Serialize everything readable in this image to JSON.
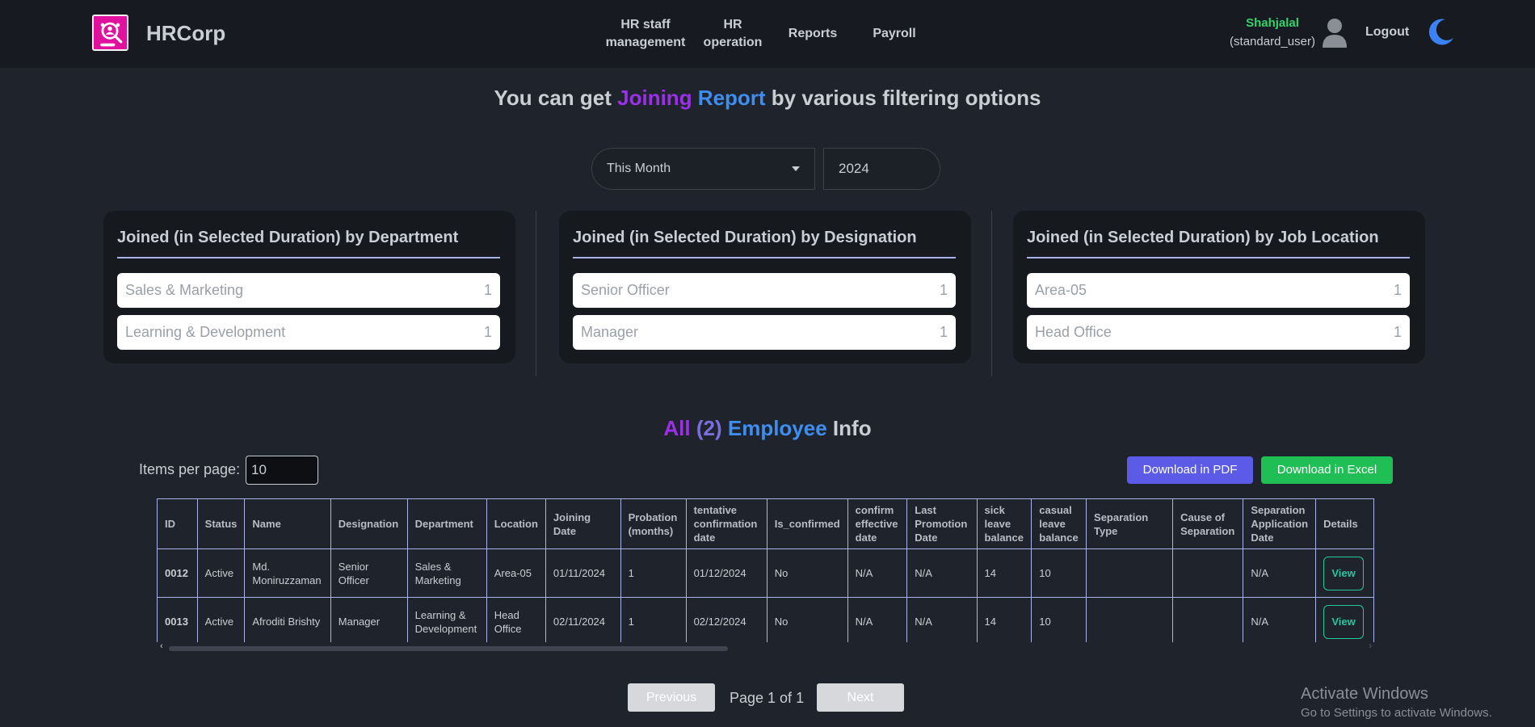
{
  "navbar": {
    "brand": "HRCorp",
    "items": [
      {
        "line1": "HR staff",
        "line2": "management"
      },
      {
        "line1": "HR",
        "line2": "operation"
      },
      {
        "line1": "Reports",
        "line2": ""
      },
      {
        "line1": "Payroll",
        "line2": ""
      }
    ],
    "user_name": "Shahjalal",
    "user_role": "(standard_user)",
    "logout": "Logout"
  },
  "heading": {
    "prefix": "You can get ",
    "word1": "Joining",
    "word2": " Report",
    "suffix": " by various filtering options"
  },
  "filters": {
    "duration": "This Month",
    "year": "2024"
  },
  "cards": [
    {
      "title": "Joined (in Selected Duration) by Department",
      "rows": [
        {
          "label": "Sales & Marketing",
          "count": "1"
        },
        {
          "label": "Learning & Development",
          "count": "1"
        }
      ]
    },
    {
      "title": "Joined (in Selected Duration) by Designation",
      "rows": [
        {
          "label": "Senior Officer",
          "count": "1"
        },
        {
          "label": "Manager",
          "count": "1"
        }
      ]
    },
    {
      "title": "Joined (in Selected Duration) by Job Location",
      "rows": [
        {
          "label": "Area-05",
          "count": "1"
        },
        {
          "label": "Head Office",
          "count": "1"
        }
      ]
    }
  ],
  "employees": {
    "heading_all": "All",
    "heading_count": " (2)",
    "heading_employee": " Employee",
    "heading_info": " Info",
    "items_per_page_label": "Items per page:",
    "items_per_page": "10",
    "download_pdf": "Download in PDF",
    "download_excel": "Download in Excel",
    "columns": [
      "ID",
      "Status",
      "Name",
      "Designation",
      "Department",
      "Location",
      "Joining Date",
      "Probation (months)",
      "tentative confirmation date",
      "Is_confirmed",
      "confirm effective date",
      "Last Promotion Date",
      "sick leave balance",
      "casual leave balance",
      "Separation Type",
      "Cause of Separation",
      "Separation Application Date",
      "Details"
    ],
    "rows": [
      {
        "id": "0012",
        "status": "Active",
        "name": "Md. Moniruzzaman",
        "designation": "Senior Officer",
        "department": "Sales & Marketing",
        "location": "Area-05",
        "joining_date": "01/11/2024",
        "probation": "1",
        "tentative": "01/12/2024",
        "is_confirmed": "No",
        "confirm_effective": "N/A",
        "last_promotion": "N/A",
        "sick": "14",
        "casual": "10",
        "sep_type": "",
        "cause": "",
        "sep_app_date": "N/A",
        "details": "View"
      },
      {
        "id": "0013",
        "status": "Active",
        "name": "Afroditi Brishty",
        "designation": "Manager",
        "department": "Learning & Development",
        "location": "Head Office",
        "joining_date": "02/11/2024",
        "probation": "1",
        "tentative": "02/12/2024",
        "is_confirmed": "No",
        "confirm_effective": "N/A",
        "last_promotion": "N/A",
        "sick": "14",
        "casual": "10",
        "sep_type": "",
        "cause": "",
        "sep_app_date": "N/A",
        "details": "View"
      }
    ]
  },
  "pagination": {
    "previous": "Previous",
    "page_info": "Page 1 of 1",
    "next": "Next"
  },
  "watermark": {
    "title": "Activate Windows",
    "subtitle": "Go to Settings to activate Windows."
  }
}
